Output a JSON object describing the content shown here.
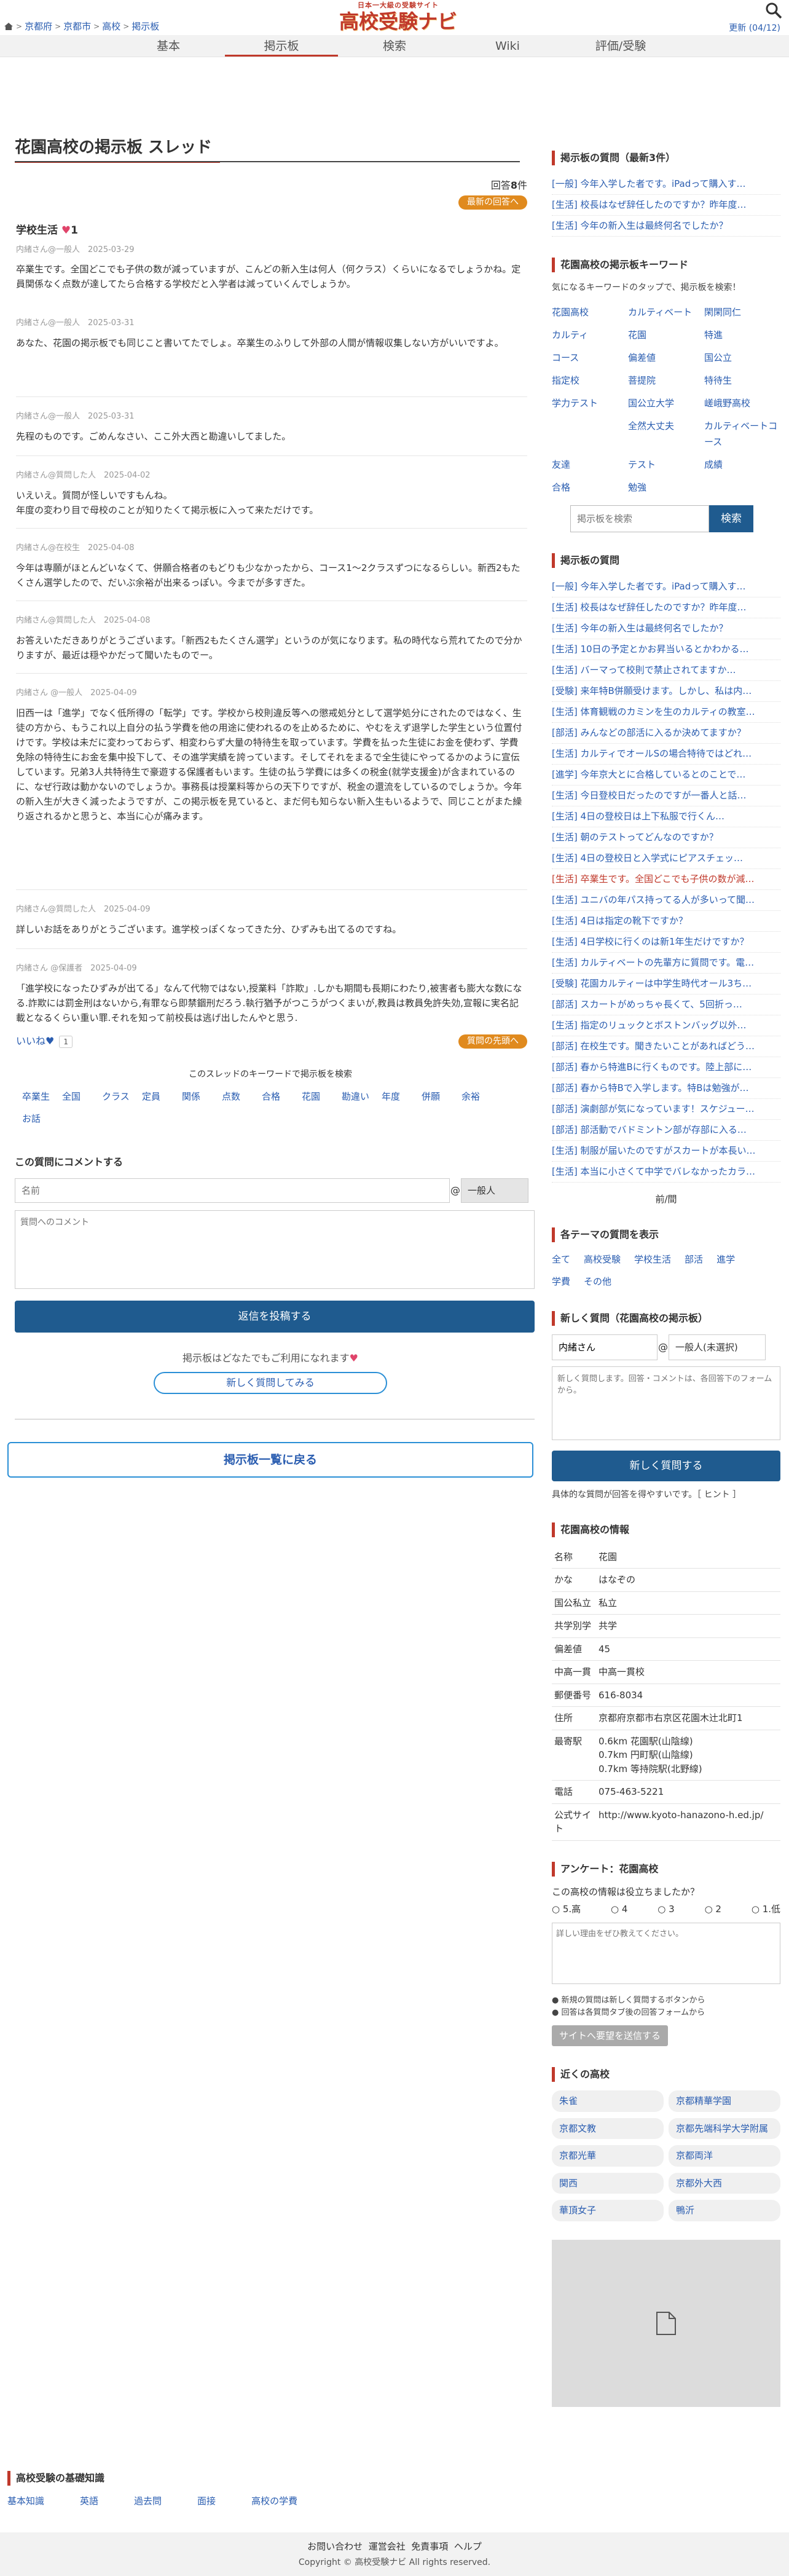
{
  "header": {
    "breadcrumbs": [
      "京都府",
      "京都市",
      "高校",
      "掲示板"
    ],
    "logo_tagline": "日本一大級の受験サイト",
    "logo_title": "高校受験ナビ",
    "update": "更新 (04/12)"
  },
  "nav": {
    "tabs": [
      "基本",
      "掲示板",
      "検索",
      "Wiki",
      "評価/受験"
    ],
    "active": 1
  },
  "thread": {
    "title": "花園高校の掲示板 スレッド",
    "answers_label": "回答",
    "answers_count": "8",
    "answers_suffix": "件",
    "newest_button": "最新の回答へ",
    "topic": "学校生活",
    "topic_likes": "1",
    "posts": [
      {
        "meta": "内緒さん@一般人　2025-03-29",
        "body": "卒業生です。全国どこでも子供の数が減っていますが、こんどの新入生は何人（何クラス）くらいになるでしょうかね。定員関係なく点数が達してたら合格する学校だと入学者は減っていくんでしょうか。"
      },
      {
        "meta": "内緒さん@一般人　2025-03-31",
        "body": "あなた、花園の掲示板でも同じこと書いてたでしょ。卒業生のふりして外部の人間が情報収集しない方がいいですよ。"
      },
      {
        "meta": "内緒さん@一般人　2025-03-31",
        "body": "先程のものです。ごめんなさい、ここ外大西と勘違いしてました。"
      },
      {
        "meta": "内緒さん@質問した人　2025-04-02",
        "body": "いえいえ。質問が怪しいですもんね。\n年度の変わり目で母校のことが知りたくて掲示板に入って来ただけです。"
      },
      {
        "meta": "内緒さん@在校生　2025-04-08",
        "body": "今年は専願がほとんどいなくて、併願合格者のもどりも少なかったから、コース1〜2クラスずつになるらしい。新西2もたくさん選学したので、だいぶ余裕が出来るっぽい。今までが多すぎた。"
      },
      {
        "meta": "内緒さん@質問した人　2025-04-08",
        "body": "お答えいただきありがとうございます。「新西2もたくさん選学」というのが気になります。私の時代なら荒れてたので分かりますが、最近は穏やかだって聞いたものでー。"
      },
      {
        "meta": "内緒さん @一般人　2025-04-09",
        "body": "旧西一は「進学」でなく低所得の「転学」です。学校から校則違反等への懲戒処分として選学処分にされたのではなく、生徒の方から、もうこれ以上自分の払う学費を他の用途に使われるのを止めるために、やむをえず退学した学生という位置付けです。学校は未だに変わっておらず、相変わらず大量の特待生を取っています。学費を払った生徒にお金を使わず、学費免除の特待生にお金を集中投下して、その進学実績を誇っています。そしてそれをまるで全生徒にやってるかのように宣伝しています。兄弟3人共特待生で豪遊する保護者もいます。生徒の払う学費には多くの税金(就学支援金)が含まれているのに、なぜ行政は動かないのでしょうか。事務長は授業料等からの天下りですが、税金の還流をしているのでしょうか。今年の新入生が大きく減ったようですが、この掲示板を見ていると、まだ何も知らない新入生もいるようで、同じことがまた繰り返されるかと思うと、本当に心が痛みます。"
      },
      {
        "meta": "内緒さん@質問した人　2025-04-09",
        "body": "詳しいお話をありがとうございます。進学校っぽくなってきた分、ひずみも出てるのですね。"
      },
      {
        "meta": "内緒さん @保護者　2025-04-09",
        "body": "「進学校になったひずみが出てる」なんて代物ではない,授業料「詐欺」.しかも期間も長期にわたり,被害者も膨大な数になる.詐欺には罰金刑はないから,有罪なら即禁錮刑だろう.執行猶予がつこうがつくまいが,教員は教員免許失効,宣報に実名記載となるくらい重い罪.それを知って前校長は逃げ出したんやと思う."
      }
    ],
    "like_label": "いいね♥",
    "like_count": "1",
    "question_button": "質問の先頭へ",
    "kw_title": "このスレッドのキーワードで掲示板を検索",
    "keywords": [
      "卒業生",
      "全国",
      "クラス",
      "定員",
      "関係",
      "点数",
      "合格",
      "花園",
      "勘違い",
      "年度",
      "併願",
      "余裕",
      "お話"
    ]
  },
  "comment": {
    "heading": "この質問にコメントする",
    "name_placeholder": "名前",
    "at": "@",
    "grade": "一般人",
    "body_placeholder": "質問へのコメント",
    "submit": "返信を投稿する",
    "free_text": "掲示板はどなたでもご利用になれます",
    "new_question": "新しく質問してみる",
    "back_to_list": "掲示板一覧に戻る"
  },
  "side": {
    "latest_title": "掲示板の質問（最新3件）",
    "latest": [
      "[一般] 今年入学した者です。iPadって購入す…",
      "[生活] 校長はなぜ辞任したのですか？昨年度…",
      "[生活] 今年の新入生は最終何名でしたか？"
    ],
    "kw_title": "花園高校の掲示板キーワード",
    "kw_text": "気になるキーワードのタップで、掲示板を検索！",
    "keywords": [
      "花園高校",
      "カルティベート",
      "閑閑同仁",
      "カルティ",
      "花園",
      "特進",
      "コース",
      "偏差値",
      "国公立",
      "指定校",
      "菩提院",
      "特待生",
      "学力テスト",
      "国公立大学",
      "嵯峨野高校",
      "",
      "全然大丈夫",
      "カルティベートコース",
      "友達",
      "テスト",
      "成績",
      "合格",
      "勉強"
    ],
    "search_placeholder": "掲示板を検索",
    "search_button": "検索",
    "questions_title": "掲示板の質問",
    "questions": [
      "[一般] 今年入学した者です。iPadって購入す…",
      "[生活] 校長はなぜ辞任したのですか？昨年度…",
      "[生活] 今年の新入生は最終何名でしたか？",
      "[生活] 10日の予定とかお昇当いるとかわかる…",
      "[生活] バーマって校則で禁止されてますか…",
      "[受験] 来年特B併願受けます。しかし、私は内…",
      "[生活] 体育観戦のカミンを生のカルティの教室…",
      "[部活] みんなどの部活に入るか決めてますか？",
      "[生活] カルティでオールSの場合特待ではどれ…",
      "[進学] 今年京大とに合格しているとのことで…",
      "[生活] 今日登校日だったのですが一番人と話…",
      "[生活] 4日の登校日は上下私服で行くん…",
      "[生活] 朝のテストってどんなのですか？",
      "[生活] 4日の登校日と入学式にピアスチェッ…",
      "[生活] 卒業生です。全国どこでも子供の数が減…",
      "[生活] ユニバの年パス持ってる人が多いって聞…",
      "[生活] 4日は指定の靴下ですか？",
      "[生活] 4日学校に行くのは新1年生だけですか？",
      "[生活] カルティベートの先輩方に質問です。電…",
      "[受験] 花園カルティーは中学生時代オール3ち…",
      "[部活] スカートがめっちゃ長くて、5回折っ…",
      "[生活] 指定のリュックとボストンバッグ以外…",
      "[部活] 在校生です。聞きたいことがあればどう…",
      "[部活] 春から特進Bに行くものです。陸上部に…",
      "[部活] 春から特Bで入学します。特Bは勉強が…",
      "[部活] 演劇部が気になっています！スケジュー…",
      "[部活] 部活動でバドミントン部が存部に入る…",
      "[生活] 制服が届いたのですがスカートが本長い…",
      "[生活] 本当に小さくて中学でバレなかったカラ…"
    ],
    "prevnext": "前/間",
    "themes_title": "各テーマの質問を表示",
    "themes": [
      "全て",
      "高校受験",
      "学校生活",
      "部活",
      "進学",
      "学費",
      "その他"
    ],
    "newq_title": "新しく質問（花園高校の掲示板）",
    "newq_name": "内緒さん",
    "newq_at": "@",
    "newq_grade": "一般人(未選択)",
    "newq_placeholder": "新しく質問します。回答・コメントは、各回答下のフォームから。",
    "newq_submit": "新しく質問する",
    "newq_hint": "具体的な質問が回答を得やすいです。［ ヒント ］",
    "info_title": "花園高校の情報",
    "info": [
      {
        "k": "名称",
        "v": "花園"
      },
      {
        "k": "かな",
        "v": "はなぞの"
      },
      {
        "k": "国公私立",
        "v": "私立"
      },
      {
        "k": "共学別学",
        "v": "共学"
      },
      {
        "k": "偏差値",
        "v": "45"
      },
      {
        "k": "中高一貫",
        "v": "中高一貫校"
      },
      {
        "k": "郵便番号",
        "v": "616-8034"
      },
      {
        "k": "住所",
        "v": "京都府京都市右京区花園木辻北町1"
      },
      {
        "k": "最寄駅",
        "v": "0.6km 花園駅(山陰線)\n0.7km 円町駅(山陰線)\n0.7km 等持院駅(北野線)"
      },
      {
        "k": "電話",
        "v": "075-463-5221"
      },
      {
        "k": "公式サイト",
        "v": "http://www.kyoto-hanazono-h.ed.jp/"
      }
    ],
    "poll_title": "アンケート：花園高校",
    "poll_q": "この高校の情報は役立ちましたか？",
    "poll_opts": [
      "5.高",
      "4",
      "3",
      "2",
      "1.低"
    ],
    "poll_placeholder": "詳しい理由をぜひ教えてください。",
    "poll_notes": [
      "新規の質問は新しく質問するボタンから",
      "回答は各質問タブ後の回答フォームから"
    ],
    "poll_send": "サイトへ要望を送信する",
    "near_title": "近くの高校",
    "near": [
      "朱雀",
      "京都精華学園",
      "京都文教",
      "京都先端科学大学附属",
      "京都光華",
      "京都両洋",
      "関西",
      "京都外大西",
      "華頂女子",
      "鴨沂"
    ]
  },
  "footer": {
    "kb_title": "高校受験の基礎知識",
    "kb_links": [
      "基本知識",
      "英語",
      "過去問",
      "面接",
      "高校の学費"
    ],
    "links": [
      "お問い合わせ",
      "運営会社",
      "免責事項",
      "ヘルプ"
    ],
    "copyright": "Copyright © 高校受験ナビ All rights reserved."
  },
  "colors": {
    "accent": "#c0392b",
    "primary": "#1f5b8f",
    "orange": "#e08a1e",
    "link": "#2a5db0"
  }
}
